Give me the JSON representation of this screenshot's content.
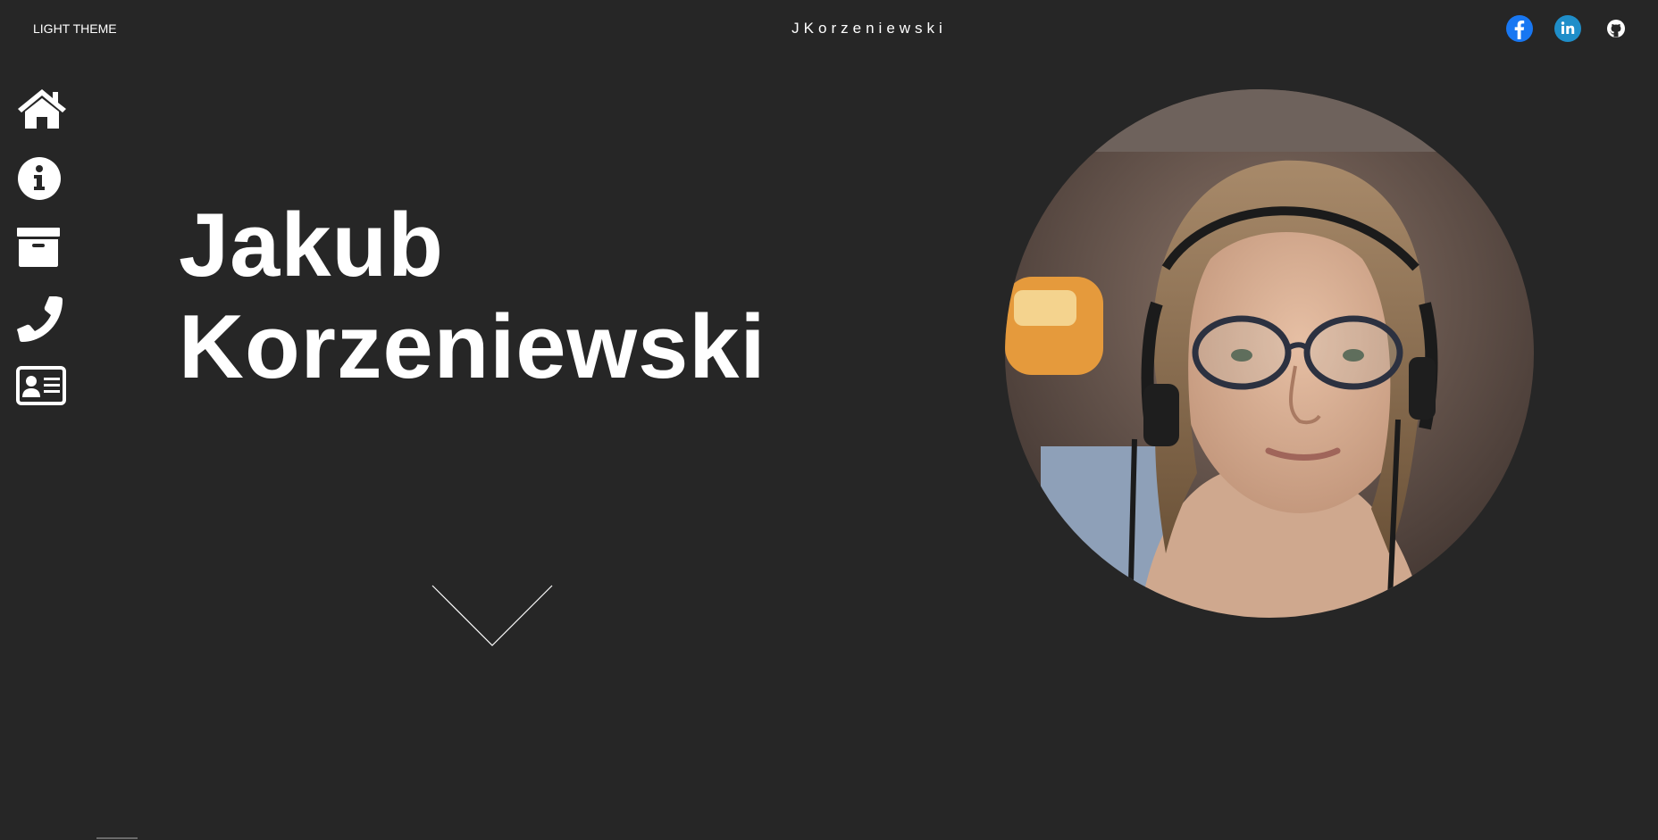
{
  "header": {
    "theme_toggle": "LIGHT THEME",
    "brand": "JKorzeniewski"
  },
  "social": {
    "items": [
      {
        "name": "facebook",
        "icon": "facebook-icon",
        "color": "#1877f2"
      },
      {
        "name": "linkedin",
        "icon": "linkedin-icon",
        "color": "#1f8ec9"
      },
      {
        "name": "github",
        "icon": "github-icon",
        "color": "#262626"
      }
    ]
  },
  "sidenav": {
    "items": [
      {
        "icon": "home-icon"
      },
      {
        "icon": "info-icon"
      },
      {
        "icon": "archive-icon"
      },
      {
        "icon": "phone-icon"
      },
      {
        "icon": "contact-card-icon"
      }
    ]
  },
  "hero": {
    "first_name": "Jakub",
    "last_name": "Korzeniewski",
    "portrait": "portrait photo of a young man with glasses and headphones"
  },
  "colors": {
    "background": "#262626",
    "text": "#ffffff"
  }
}
